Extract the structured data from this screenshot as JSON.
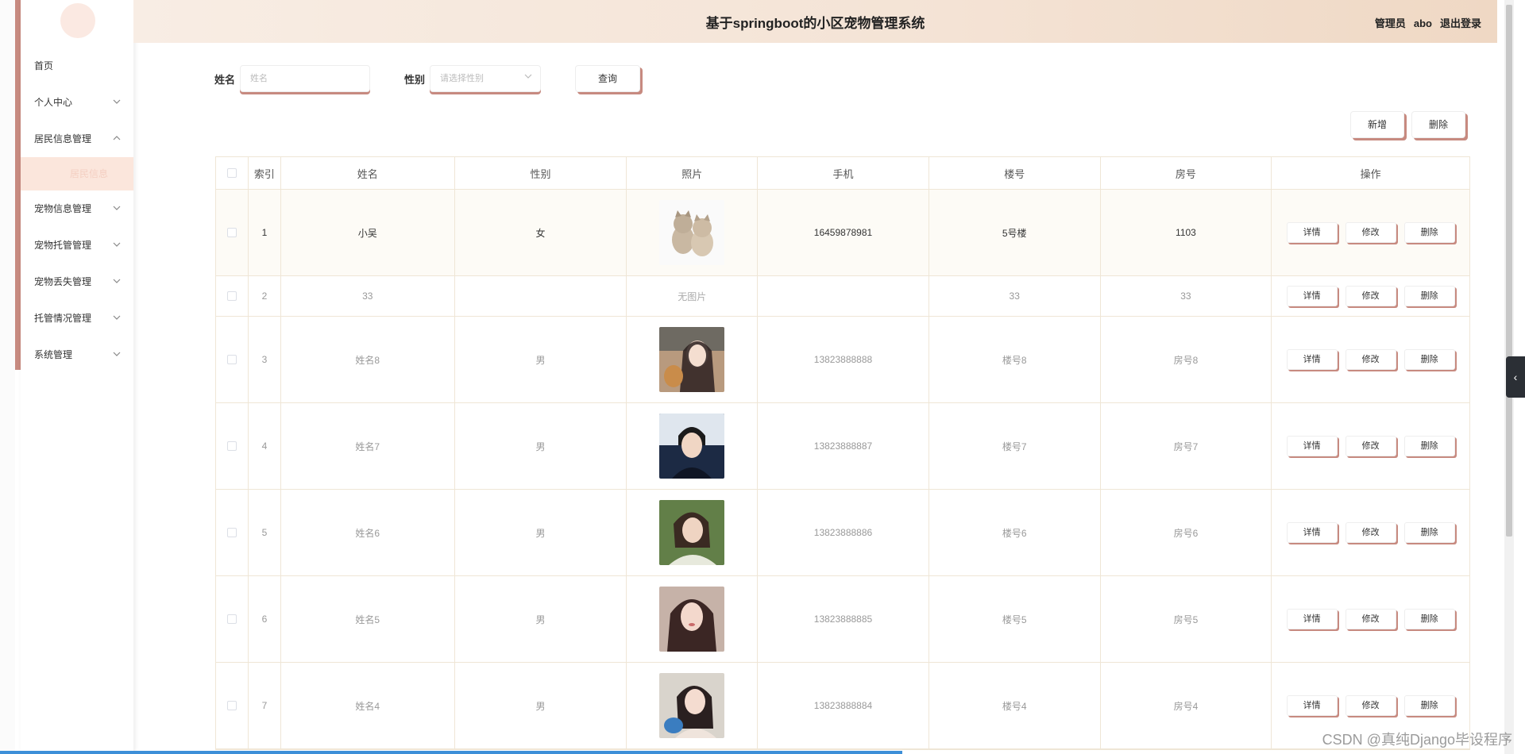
{
  "header": {
    "title": "基于springboot的小区宠物管理系统",
    "role": "管理员",
    "username": "abo",
    "logout": "退出登录"
  },
  "sidebar": {
    "items": [
      {
        "label": "首页"
      },
      {
        "label": "个人中心"
      },
      {
        "label": "居民信息管理"
      },
      {
        "label": "居民信息"
      },
      {
        "label": "宠物信息管理"
      },
      {
        "label": "宠物托管管理"
      },
      {
        "label": "宠物丢失管理"
      },
      {
        "label": "托管情况管理"
      },
      {
        "label": "系统管理"
      }
    ]
  },
  "filters": {
    "name_label": "姓名",
    "name_placeholder": "姓名",
    "sex_label": "性别",
    "sex_placeholder": "请选择性别",
    "query_button": "查询"
  },
  "toolbar": {
    "add": "新增",
    "delete": "删除"
  },
  "table": {
    "columns": [
      "索引",
      "姓名",
      "性别",
      "照片",
      "手机",
      "楼号",
      "房号",
      "操作"
    ],
    "no_photo_text": "无图片",
    "op_labels": {
      "detail": "详情",
      "edit": "修改",
      "delete": "删除"
    },
    "rows": [
      {
        "index": "1",
        "name": "小吴",
        "sex": "女",
        "phone": "16459878981",
        "building": "5号楼",
        "room": "1103"
      },
      {
        "index": "2",
        "name": "33",
        "sex": "",
        "phone": "",
        "building": "33",
        "room": "33"
      },
      {
        "index": "3",
        "name": "姓名8",
        "sex": "男",
        "phone": "13823888888",
        "building": "楼号8",
        "room": "房号8"
      },
      {
        "index": "4",
        "name": "姓名7",
        "sex": "男",
        "phone": "13823888887",
        "building": "楼号7",
        "room": "房号7"
      },
      {
        "index": "5",
        "name": "姓名6",
        "sex": "男",
        "phone": "13823888886",
        "building": "楼号6",
        "room": "房号6"
      },
      {
        "index": "6",
        "name": "姓名5",
        "sex": "男",
        "phone": "13823888885",
        "building": "楼号5",
        "room": "房号5"
      },
      {
        "index": "7",
        "name": "姓名4",
        "sex": "男",
        "phone": "13823888884",
        "building": "楼号4",
        "room": "房号4"
      }
    ]
  },
  "watermark": "CSDN @真纯Django毕设程序"
}
